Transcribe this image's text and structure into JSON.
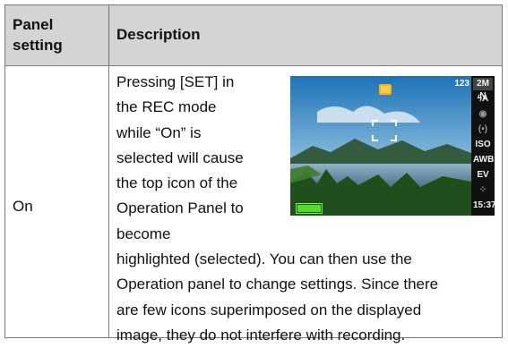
{
  "table": {
    "header": {
      "panel_setting": [
        "Panel",
        "setting"
      ],
      "description": "Description"
    },
    "row": {
      "setting": "On",
      "description_lines_top": [
        "Pressing [SET] in",
        "the REC mode",
        "while “On” is",
        "selected will cause",
        "the top icon of the",
        "Operation Panel to",
        "become"
      ],
      "description_lines_bottom": [
        "highlighted (selected). You can then use the",
        "Operation panel to change settings. Since there",
        "are few icons superimposed on the displayed",
        "image, they do not interfere with recording."
      ]
    }
  },
  "camera_screen": {
    "shot_counter": "123",
    "side_icons": [
      "2M N",
      "ϟA",
      "◉",
      "(•)",
      "ISO",
      "AWB",
      "EV",
      "⁘",
      "15:37"
    ],
    "battery_level": 1.0,
    "colors": {
      "sky": "#9bd0ef",
      "lake": "#4d6f86",
      "land": "#3b6a2b"
    }
  }
}
